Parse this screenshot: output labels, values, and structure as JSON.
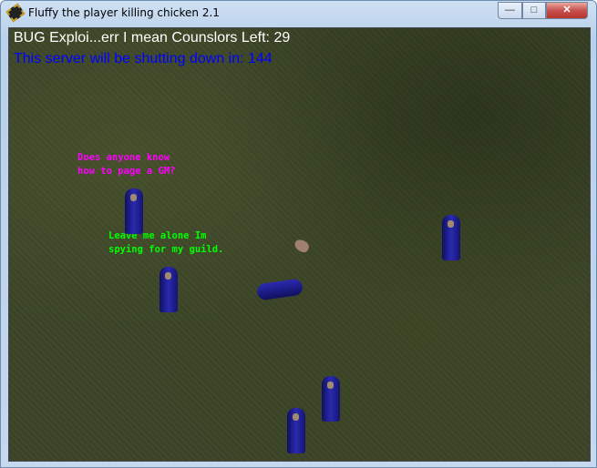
{
  "window": {
    "title": "Fluffy the player killing chicken 2.1",
    "minimize": "—",
    "maximize": "□",
    "close": "✕"
  },
  "hud": {
    "counselors_text": "BUG Exploi...err I mean Counslors Left: 29",
    "shutdown_text": "This server will be shutting down in: 144"
  },
  "speech": [
    {
      "text": "Does anyone know\nhow to page a GM?",
      "color": "#ff00ff"
    },
    {
      "text": "Leave me alone Im\nspying for my guild.",
      "color": "#00ff00"
    }
  ]
}
